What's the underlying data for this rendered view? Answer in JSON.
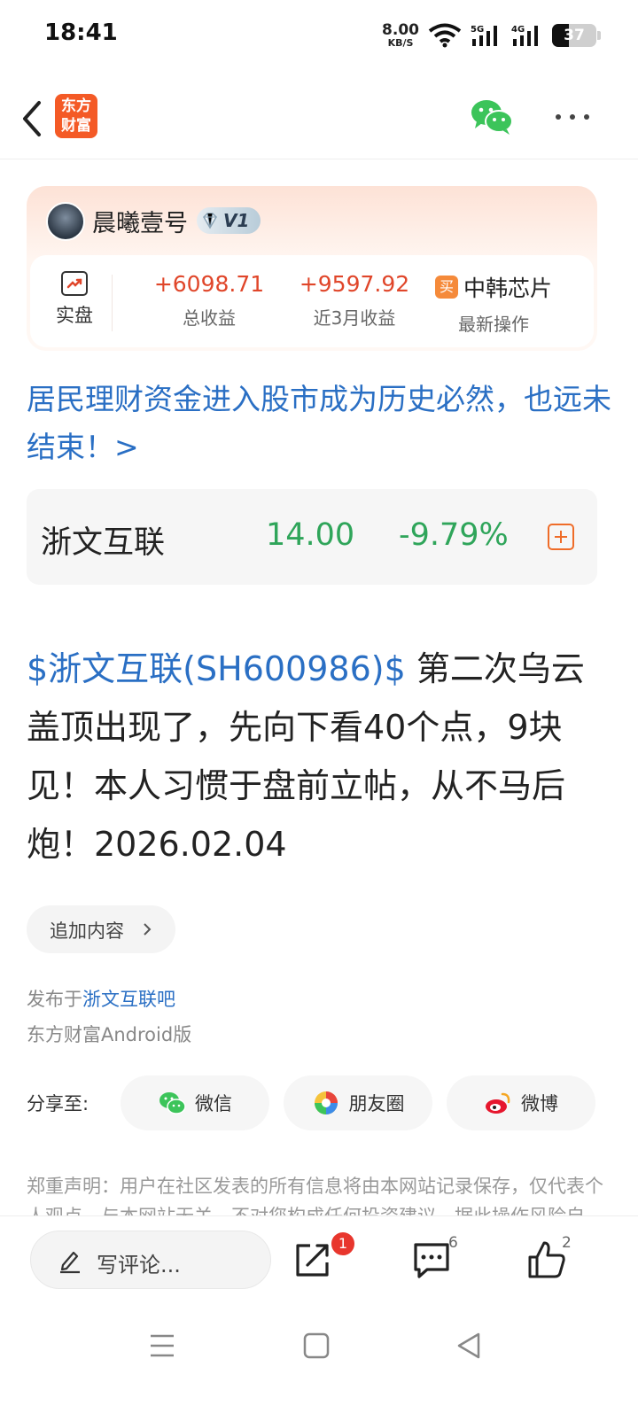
{
  "status": {
    "time": "18:41",
    "speed_value": "8.00",
    "speed_unit": "KB/S",
    "battery": "37",
    "net1": "5G",
    "net2": "4G"
  },
  "header": {
    "logo_line1": "东方",
    "logo_line2": "财富"
  },
  "user": {
    "name": "晨曦壹号",
    "level": "V1",
    "real_label": "实盘",
    "total_gain_value": "+6098.71",
    "total_gain_label": "总收益",
    "three_month_value": "+9597.92",
    "three_month_label": "近3月收益",
    "buy_tag": "买",
    "latest_stock": "中韩芯片",
    "latest_label": "最新操作"
  },
  "headline": "居民理财资金进入股市成为历史必然，也远未结束！>",
  "stock": {
    "name": "浙文互联",
    "price": "14.00",
    "change": "-9.79%"
  },
  "post": {
    "tag": "$浙文互联(SH600986)$",
    "text": " 第二次乌云盖顶出现了，先向下看40个点，9块见！本人习惯于盘前立帖，从不马后炮！2026.02.04"
  },
  "add_content": "追加内容",
  "publish": {
    "prefix": "发布于",
    "forum": "浙文互联吧",
    "platform": "东方财富Android版"
  },
  "share": {
    "label": "分享至:",
    "wechat": "微信",
    "moments": "朋友圈",
    "weibo": "微博"
  },
  "disclaimer": "郑重声明：用户在社区发表的所有信息将由本网站记录保存，仅代表个人观点，与本网站无关，不对您构成任何投资建议，据此操作风险自担。",
  "bottom": {
    "comment_placeholder": "写评论...",
    "share_badge": "1",
    "comment_count": "6",
    "like_count": "2"
  }
}
